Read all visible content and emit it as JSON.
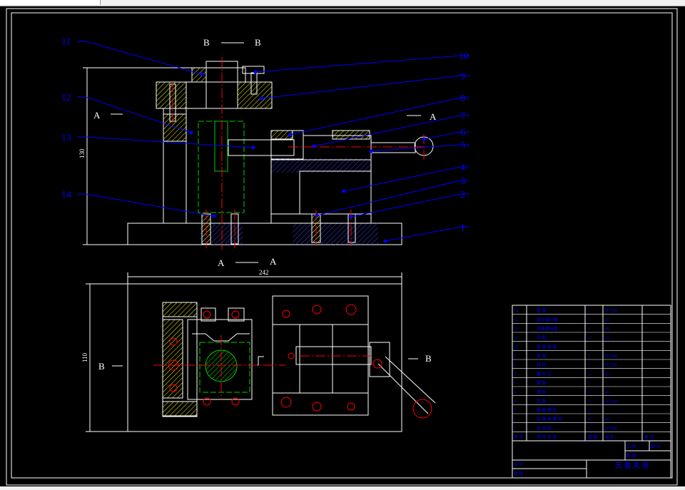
{
  "callouts": [
    "1",
    "2",
    "3",
    "4",
    "5",
    "6",
    "7",
    "8",
    "9",
    "10",
    "11",
    "12",
    "13",
    "14"
  ],
  "section_labels": {
    "bb_top_left": "B",
    "bb_top_right": "B",
    "aa_left": "A",
    "aa_right_a": "A",
    "aa_bottom_left": "A",
    "aa_bottom_right": "A",
    "b_side_left": "B",
    "b_side_right": "B"
  },
  "dimensions": {
    "height_top": "130",
    "width_bottom": "242",
    "height_bottom": "110"
  },
  "title_block": {
    "title": "五 盘 夫 务",
    "rows": [
      [
        "14",
        "垫 板",
        "1",
        "HT200"
      ],
      [
        "13",
        "定位销钉板",
        "1",
        "45"
      ],
      [
        "12",
        "压紧螺母板",
        "1",
        "45"
      ],
      [
        "11",
        "钻 套",
        "1",
        "45"
      ],
      [
        "10",
        "夹 具 体 板",
        "",
        ""
      ],
      [
        "9",
        "支 座",
        "1",
        "HT200"
      ],
      [
        "8",
        "销 柱",
        "1",
        "HT200"
      ],
      [
        "7",
        "螺 杆 钉",
        "1",
        "45"
      ],
      [
        "6",
        "套 筒",
        "1",
        ""
      ],
      [
        "5",
        "螺 柱",
        "1",
        "45"
      ],
      [
        "4",
        "压 板",
        "1",
        "HT200"
      ],
      [
        "3",
        "螺 母 螺 栓",
        "2",
        ""
      ],
      [
        "2",
        "钻 模 板 螺 栓",
        "8",
        "45"
      ],
      [
        "1",
        "夹 具 体",
        "1",
        "HT200"
      ],
      [
        "序 号",
        "零 件 名 称",
        "数 量",
        "材 料",
        "备 注"
      ]
    ],
    "small": [
      "比 例",
      "图 号",
      "数 量",
      "共 张",
      "第 张",
      "设 计",
      "审 核"
    ]
  },
  "colors": {
    "outline": "#ffffff",
    "leader": "#0000ff",
    "center": "#ff0000",
    "hatch": "#ffff00",
    "hidden": "#00cc00"
  }
}
